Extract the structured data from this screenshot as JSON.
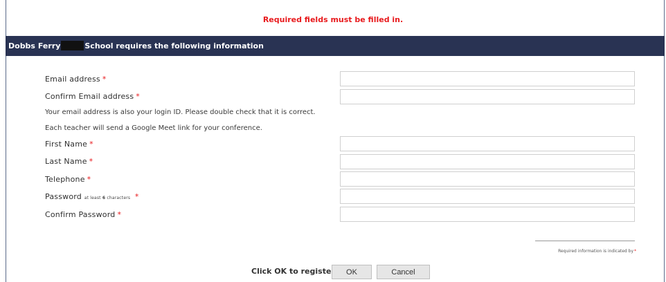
{
  "header": {
    "required_message": "Required fields must be filled in.",
    "banner_prefix": "Dobbs Ferry",
    "banner_suffix": "School requires the following information"
  },
  "form": {
    "email_label": "Email address",
    "confirm_email_label": "Confirm Email address",
    "note_login": "Your email address is also your login ID. Please double check that it is correct.",
    "note_meet": "Each teacher will send a Google Meet link for your conference.",
    "first_name_label": "First Name",
    "last_name_label": "Last Name",
    "telephone_label": "Telephone",
    "password_label": "Password",
    "password_hint_prefix": "at least",
    "password_hint_number": "6",
    "password_hint_suffix": "characters",
    "confirm_password_label": "Confirm Password",
    "required_star": "*",
    "values": {
      "email": "",
      "confirm_email": "",
      "first_name": "",
      "last_name": "",
      "telephone": "",
      "password": "",
      "confirm_password": ""
    }
  },
  "footer": {
    "legend_text": "Required information is indicated by",
    "legend_star": "*",
    "click_label": "Click OK to register",
    "ok_label": "OK",
    "cancel_label": "Cancel"
  },
  "colors": {
    "banner_bg": "#293353",
    "required_red": "#e8191c",
    "button_bg": "#e6e6e6"
  }
}
